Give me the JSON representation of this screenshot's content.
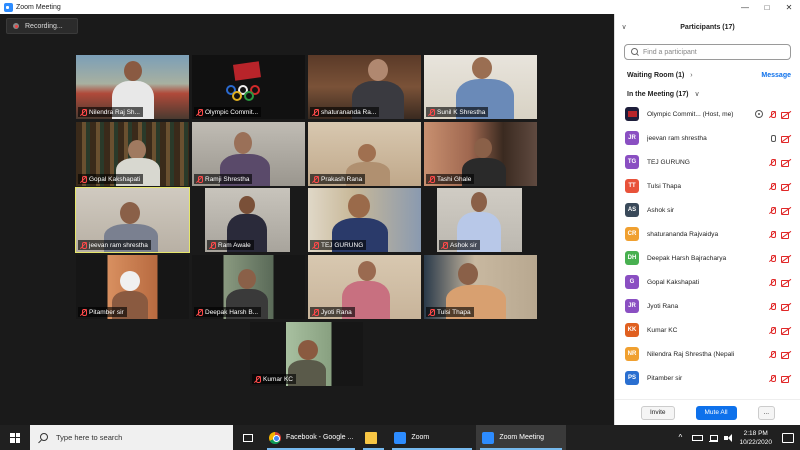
{
  "window": {
    "title": "Zoom Meeting",
    "controls": [
      "—",
      "□",
      "✕"
    ]
  },
  "recording": {
    "label": "Recording..."
  },
  "tiles": [
    {
      "name": "Nilendra Raj Sh..."
    },
    {
      "name": "Olympic Commit..."
    },
    {
      "name": "shaturananda Ra..."
    },
    {
      "name": "Sunil K Shrestha"
    },
    {
      "name": "Gopal Kakshapati"
    },
    {
      "name": "Ramji Shrestha"
    },
    {
      "name": "Prakash Rana"
    },
    {
      "name": "Tashi Ghale"
    },
    {
      "name": "jeevan ram shrestha"
    },
    {
      "name": "Ram Awale"
    },
    {
      "name": "TEJ GURUNG"
    },
    {
      "name": "Ashok sir"
    },
    {
      "name": "Pitamber sir"
    },
    {
      "name": "Deepak Harsh B..."
    },
    {
      "name": "Jyoti Rana"
    },
    {
      "name": "Tulsi Thapa"
    },
    {
      "name": "Kumar KC"
    }
  ],
  "panel": {
    "title": "Participants (17)",
    "search_placeholder": "Find a participant",
    "waiting_room": "Waiting Room (1)",
    "message": "Message",
    "in_meeting": "In the Meeting (17)",
    "participants": [
      {
        "initials": "",
        "name": "Olympic Commit... (Host, me)",
        "color": "#1d1d3a"
      },
      {
        "initials": "JR",
        "name": "jeevan ram shrestha",
        "color": "#8a4fc2"
      },
      {
        "initials": "TG",
        "name": "TEJ GURUNG",
        "color": "#8a4fc2"
      },
      {
        "initials": "TT",
        "name": "Tulsi Thapa",
        "color": "#e8523a"
      },
      {
        "initials": "AS",
        "name": "Ashok sir",
        "color": "#3a4a5a"
      },
      {
        "initials": "CR",
        "name": "shaturananda Rajvaidya",
        "color": "#f0a030"
      },
      {
        "initials": "DH",
        "name": "Deepak Harsh Bajracharya",
        "color": "#48b050"
      },
      {
        "initials": "G",
        "name": "Gopal Kakshapati",
        "color": "#8a4fc2"
      },
      {
        "initials": "JR",
        "name": "Jyoti Rana",
        "color": "#8a4fc2"
      },
      {
        "initials": "KK",
        "name": "Kumar KC",
        "color": "#e06020"
      },
      {
        "initials": "NR",
        "name": "Nilendra Raj Shrestha (Nepali",
        "color": "#f0a030"
      },
      {
        "initials": "PS",
        "name": "Pitamber sir",
        "color": "#2a6fd0"
      }
    ],
    "buttons": {
      "invite": "Invite",
      "mute_all": "Mute All",
      "more": "..."
    }
  },
  "taskbar": {
    "search_placeholder": "Type here to search",
    "apps": [
      {
        "label": "Facebook - Google ..."
      },
      {
        "label": ""
      },
      {
        "label": "Zoom"
      },
      {
        "label": "Zoom Meeting"
      }
    ],
    "time": "2:18 PM",
    "date": "10/22/2020"
  }
}
